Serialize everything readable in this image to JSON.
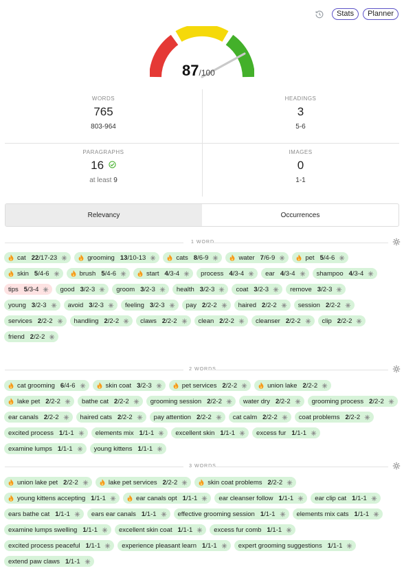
{
  "header": {
    "stats_label": "Stats",
    "planner_label": "Planner"
  },
  "score": {
    "value": "87",
    "max": "/100"
  },
  "stats": {
    "words": {
      "label": "WORDS",
      "value": "765",
      "target": "803-964"
    },
    "headings": {
      "label": "HEADINGS",
      "value": "3",
      "target": "5-6"
    },
    "paragraphs": {
      "label": "PARAGRAPHS",
      "value": "16",
      "prefix": "at least",
      "target": "9"
    },
    "images": {
      "label": "IMAGES",
      "value": "0",
      "target": "1-1"
    }
  },
  "tabs": [
    {
      "label": "Relevancy",
      "active": true
    },
    {
      "label": "Occurrences",
      "active": false
    }
  ],
  "colors": {
    "gauge_red": "#e53935",
    "gauge_yellow": "#f5d90a",
    "gauge_green": "#43b02a",
    "chip_ok": "#d7f3d9",
    "chip_bad": "#fde2e2",
    "accent": "#5b52c7"
  },
  "sections": [
    {
      "title": "1 WORD",
      "keywords": [
        {
          "kw": "cat",
          "count": "22",
          "target": "/17-23",
          "flame": true
        },
        {
          "kw": "grooming",
          "count": "13",
          "target": "/10-13",
          "flame": true
        },
        {
          "kw": "cats",
          "count": "8",
          "target": "/6-9",
          "flame": true
        },
        {
          "kw": "water",
          "count": "7",
          "target": "/6-9",
          "flame": true
        },
        {
          "kw": "pet",
          "count": "5",
          "target": "/4-6",
          "flame": true
        },
        {
          "kw": "skin",
          "count": "5",
          "target": "/4-6",
          "flame": true
        },
        {
          "kw": "brush",
          "count": "5",
          "target": "/4-6",
          "flame": true
        },
        {
          "kw": "start",
          "count": "4",
          "target": "/3-4",
          "flame": true
        },
        {
          "kw": "process",
          "count": "4",
          "target": "/3-4",
          "flame": false
        },
        {
          "kw": "ear",
          "count": "4",
          "target": "/3-4",
          "flame": false
        },
        {
          "kw": "shampoo",
          "count": "4",
          "target": "/3-4",
          "flame": false
        },
        {
          "kw": "tips",
          "count": "5",
          "target": "/3-4",
          "flame": false,
          "over": true
        },
        {
          "kw": "good",
          "count": "3",
          "target": "/2-3",
          "flame": false
        },
        {
          "kw": "groom",
          "count": "3",
          "target": "/2-3",
          "flame": false
        },
        {
          "kw": "health",
          "count": "3",
          "target": "/2-3",
          "flame": false
        },
        {
          "kw": "coat",
          "count": "3",
          "target": "/2-3",
          "flame": false
        },
        {
          "kw": "remove",
          "count": "3",
          "target": "/2-3",
          "flame": false
        },
        {
          "kw": "young",
          "count": "3",
          "target": "/2-3",
          "flame": false
        },
        {
          "kw": "avoid",
          "count": "3",
          "target": "/2-3",
          "flame": false
        },
        {
          "kw": "feeling",
          "count": "3",
          "target": "/2-3",
          "flame": false
        },
        {
          "kw": "pay",
          "count": "2",
          "target": "/2-2",
          "flame": false
        },
        {
          "kw": "haired",
          "count": "2",
          "target": "/2-2",
          "flame": false
        },
        {
          "kw": "session",
          "count": "2",
          "target": "/2-2",
          "flame": false
        },
        {
          "kw": "services",
          "count": "2",
          "target": "/2-2",
          "flame": false
        },
        {
          "kw": "handling",
          "count": "2",
          "target": "/2-2",
          "flame": false
        },
        {
          "kw": "claws",
          "count": "2",
          "target": "/2-2",
          "flame": false
        },
        {
          "kw": "clean",
          "count": "2",
          "target": "/2-2",
          "flame": false
        },
        {
          "kw": "cleanser",
          "count": "2",
          "target": "/2-2",
          "flame": false
        },
        {
          "kw": "clip",
          "count": "2",
          "target": "/2-2",
          "flame": false
        },
        {
          "kw": "friend",
          "count": "2",
          "target": "/2-2",
          "flame": false
        }
      ]
    },
    {
      "title": "2 WORDS",
      "keywords": [
        {
          "kw": "cat grooming",
          "count": "6",
          "target": "/4-6",
          "flame": true
        },
        {
          "kw": "skin coat",
          "count": "3",
          "target": "/2-3",
          "flame": true
        },
        {
          "kw": "pet services",
          "count": "2",
          "target": "/2-2",
          "flame": true
        },
        {
          "kw": "union lake",
          "count": "2",
          "target": "/2-2",
          "flame": true
        },
        {
          "kw": "lake pet",
          "count": "2",
          "target": "/2-2",
          "flame": true
        },
        {
          "kw": "bathe cat",
          "count": "2",
          "target": "/2-2",
          "flame": false
        },
        {
          "kw": "grooming session",
          "count": "2",
          "target": "/2-2",
          "flame": false
        },
        {
          "kw": "water dry",
          "count": "2",
          "target": "/2-2",
          "flame": false
        },
        {
          "kw": "grooming process",
          "count": "2",
          "target": "/2-2",
          "flame": false
        },
        {
          "kw": "ear canals",
          "count": "2",
          "target": "/2-2",
          "flame": false
        },
        {
          "kw": "haired cats",
          "count": "2",
          "target": "/2-2",
          "flame": false
        },
        {
          "kw": "pay attention",
          "count": "2",
          "target": "/2-2",
          "flame": false
        },
        {
          "kw": "cat calm",
          "count": "2",
          "target": "/2-2",
          "flame": false
        },
        {
          "kw": "coat problems",
          "count": "2",
          "target": "/2-2",
          "flame": false
        },
        {
          "kw": "excited process",
          "count": "1",
          "target": "/1-1",
          "flame": false
        },
        {
          "kw": "elements mix",
          "count": "1",
          "target": "/1-1",
          "flame": false
        },
        {
          "kw": "excellent skin",
          "count": "1",
          "target": "/1-1",
          "flame": false
        },
        {
          "kw": "excess fur",
          "count": "1",
          "target": "/1-1",
          "flame": false
        },
        {
          "kw": "examine lumps",
          "count": "1",
          "target": "/1-1",
          "flame": false
        },
        {
          "kw": "young kittens",
          "count": "1",
          "target": "/1-1",
          "flame": false
        }
      ]
    },
    {
      "title": "3 WORDS",
      "keywords": [
        {
          "kw": "union lake pet",
          "count": "2",
          "target": "/2-2",
          "flame": true
        },
        {
          "kw": "lake pet services",
          "count": "2",
          "target": "/2-2",
          "flame": true
        },
        {
          "kw": "skin coat problems",
          "count": "2",
          "target": "/2-2",
          "flame": true
        },
        {
          "kw": "young kittens accepting",
          "count": "1",
          "target": "/1-1",
          "flame": true
        },
        {
          "kw": "ear canals opt",
          "count": "1",
          "target": "/1-1",
          "flame": true
        },
        {
          "kw": "ear cleanser follow",
          "count": "1",
          "target": "/1-1",
          "flame": false
        },
        {
          "kw": "ear clip cat",
          "count": "1",
          "target": "/1-1",
          "flame": false
        },
        {
          "kw": "ears bathe cat",
          "count": "1",
          "target": "/1-1",
          "flame": false
        },
        {
          "kw": "ears ear canals",
          "count": "1",
          "target": "/1-1",
          "flame": false
        },
        {
          "kw": "effective grooming session",
          "count": "1",
          "target": "/1-1",
          "flame": false
        },
        {
          "kw": "elements mix cats",
          "count": "1",
          "target": "/1-1",
          "flame": false
        },
        {
          "kw": "examine lumps swelling",
          "count": "1",
          "target": "/1-1",
          "flame": false
        },
        {
          "kw": "excellent skin coat",
          "count": "1",
          "target": "/1-1",
          "flame": false
        },
        {
          "kw": "excess fur comb",
          "count": "1",
          "target": "/1-1",
          "flame": false
        },
        {
          "kw": "excited process peaceful",
          "count": "1",
          "target": "/1-1",
          "flame": false
        },
        {
          "kw": "experience pleasant learn",
          "count": "1",
          "target": "/1-1",
          "flame": false
        },
        {
          "kw": "expert grooming suggestions",
          "count": "1",
          "target": "/1-1",
          "flame": false
        },
        {
          "kw": "extend paw claws",
          "count": "1",
          "target": "/1-1",
          "flame": false
        }
      ]
    }
  ]
}
